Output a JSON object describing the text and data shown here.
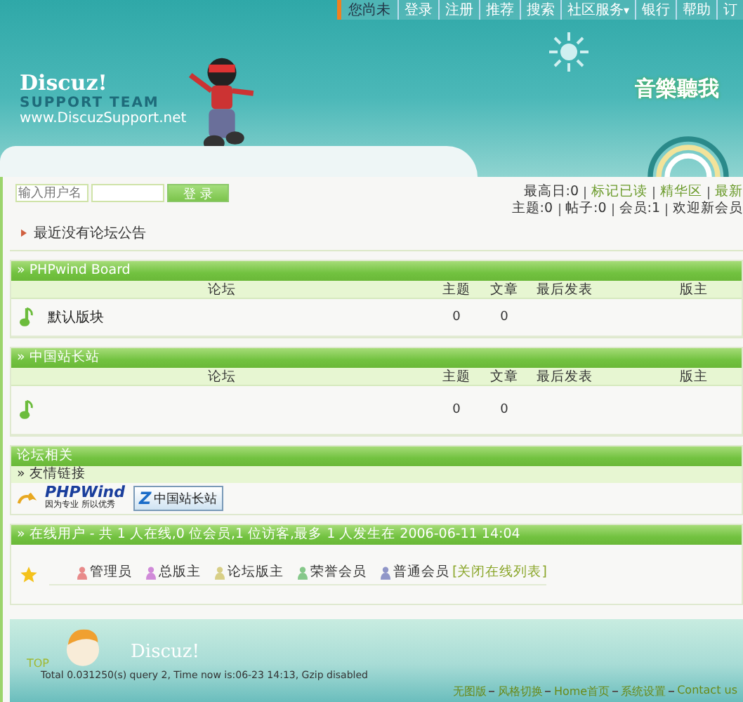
{
  "top_nav": [
    {
      "label": "您尚未",
      "kind": "text"
    },
    {
      "label": "登录",
      "kind": "link"
    },
    {
      "label": "注册",
      "kind": "link"
    },
    {
      "label": "推荐",
      "kind": "link"
    },
    {
      "label": "搜索",
      "kind": "link"
    },
    {
      "label": "社区服务",
      "kind": "menu",
      "caret": "▾"
    },
    {
      "label": "银行",
      "kind": "link"
    },
    {
      "label": "帮助",
      "kind": "link"
    },
    {
      "label": "订",
      "kind": "link"
    }
  ],
  "banner": {
    "logo": "Discuz!",
    "team": "SUPPORT TEAM",
    "url": "www.DiscuzSupport.net",
    "slogan": "音樂聽我"
  },
  "login": {
    "username_placeholder": "输入用户名",
    "button": "登 录"
  },
  "stats": [
    [
      {
        "text": "最高日:0",
        "kind": "text"
      },
      {
        "text": "标记已读",
        "kind": "link"
      },
      {
        "text": "精华区",
        "kind": "link"
      },
      {
        "text": "最新",
        "kind": "link"
      }
    ],
    [
      {
        "text": "主题:0",
        "kind": "text"
      },
      {
        "text": "帖子:0",
        "kind": "text"
      },
      {
        "text": "会员:1",
        "kind": "text"
      },
      {
        "text": "欢迎新会员",
        "kind": "text"
      }
    ]
  ],
  "announcement": "最近没有论坛公告",
  "categories": [
    {
      "title": "» PHPwind Board",
      "columns": [
        "论坛",
        "主题",
        "文章",
        "最后发表",
        "版主"
      ],
      "forums": [
        {
          "name": "默认版块",
          "topics": "0",
          "posts": "0"
        }
      ]
    },
    {
      "title": "» 中国站长站",
      "columns": [
        "论坛",
        "主题",
        "文章",
        "最后发表",
        "版主"
      ],
      "forums": [
        {
          "topics": "0",
          "posts": "0"
        }
      ]
    }
  ],
  "related": {
    "title": "论坛相关",
    "links_title": "» 友情链接",
    "logos": [
      {
        "main": "PHPWind",
        "sub": "因为专业 所以优秀"
      },
      {
        "mark": "Z",
        "main": "中国站长站"
      }
    ]
  },
  "online": {
    "summary": "» 在线用户 - 共 1 人在线,0 位会员,1 位访客,最多 1 人发生在 2006-06-11 14:04",
    "groups": [
      {
        "label": "管理员",
        "color": "#e88a8a"
      },
      {
        "label": "总版主",
        "color": "#d08ad8"
      },
      {
        "label": "论坛版主",
        "color": "#d8cf86"
      },
      {
        "label": "荣誉会员",
        "color": "#86c88a"
      },
      {
        "label": "普通会员",
        "color": "#9096c8"
      }
    ],
    "toggle": "[关闭在线列表]"
  },
  "footer": {
    "top": "TOP",
    "logo": "Discuz!",
    "stats": "Total 0.031250(s) query 2, Time now is:06-23 14:13, Gzip disabled",
    "links": [
      "无图版",
      "风格切换",
      "Home首页",
      "系统设置",
      "Contact us"
    ]
  }
}
